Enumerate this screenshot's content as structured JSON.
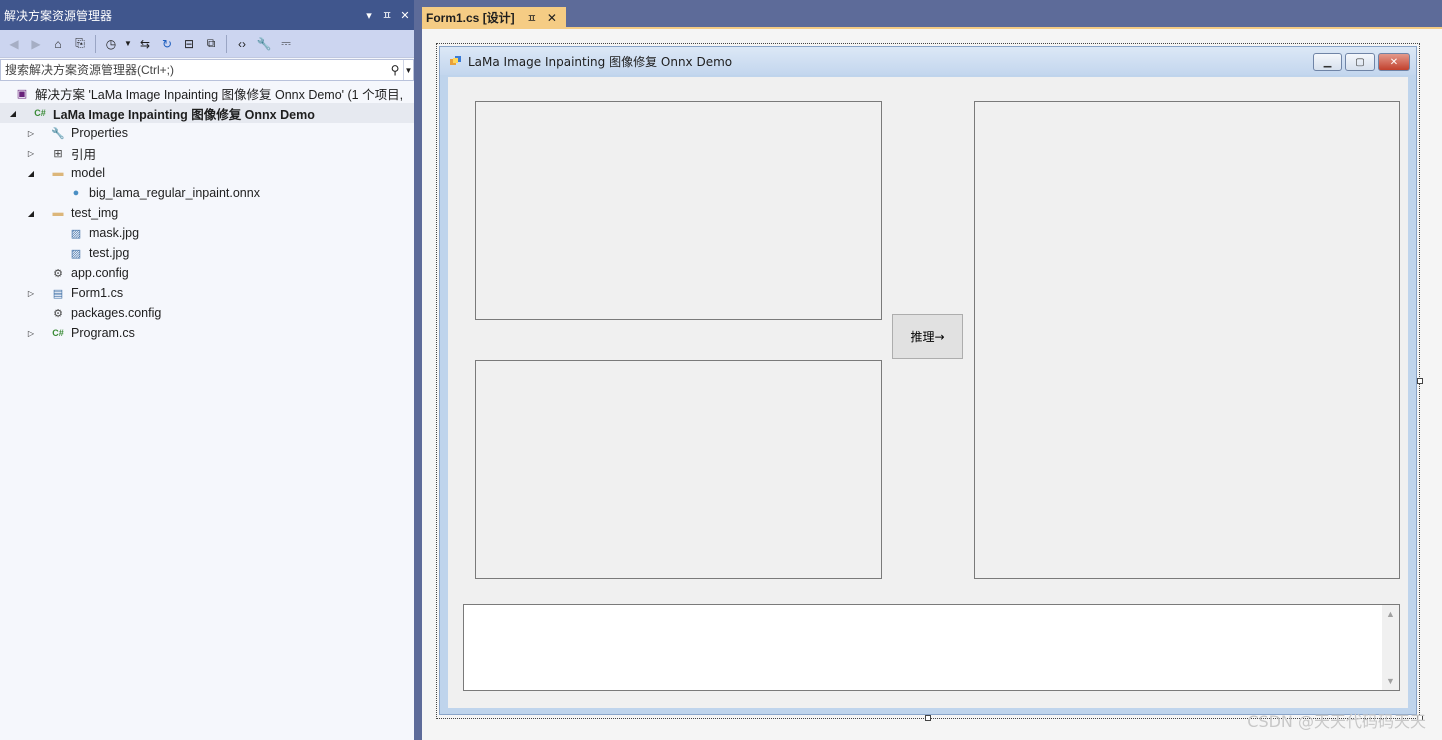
{
  "solution_explorer": {
    "title": "解决方案资源管理器",
    "title_buttons": [
      "▾",
      "ㅍ",
      "✕"
    ],
    "search_placeholder": "搜索解决方案资源管理器(Ctrl+;)",
    "tree": [
      {
        "label": "解决方案 'LaMa Image Inpainting 图像修复 Onnx Demo' (1 个项目,",
        "icon": "solution-icon",
        "depth": 0,
        "arrow": ""
      },
      {
        "label": "LaMa Image Inpainting 图像修复 Onnx Demo",
        "icon": "csharp-project-icon",
        "depth": 0,
        "arrow": "◢",
        "bold": true,
        "selected": true
      },
      {
        "label": "Properties",
        "icon": "wrench-icon",
        "depth": 1,
        "arrow": "▷"
      },
      {
        "label": "引用",
        "icon": "references-icon",
        "depth": 1,
        "arrow": "▷"
      },
      {
        "label": "model",
        "icon": "folder-icon",
        "depth": 1,
        "arrow": "◢"
      },
      {
        "label": "big_lama_regular_inpaint.onnx",
        "icon": "globe-file-icon",
        "depth": 2,
        "arrow": ""
      },
      {
        "label": "test_img",
        "icon": "folder-icon",
        "depth": 1,
        "arrow": "◢"
      },
      {
        "label": "mask.jpg",
        "icon": "image-file-icon",
        "depth": 2,
        "arrow": ""
      },
      {
        "label": "test.jpg",
        "icon": "image-file-icon",
        "depth": 2,
        "arrow": ""
      },
      {
        "label": "app.config",
        "icon": "config-file-icon",
        "depth": 1,
        "arrow": ""
      },
      {
        "label": "Form1.cs",
        "icon": "form-icon",
        "depth": 1,
        "arrow": "▷"
      },
      {
        "label": "packages.config",
        "icon": "config-file-icon",
        "depth": 1,
        "arrow": ""
      },
      {
        "label": "Program.cs",
        "icon": "csharp-file-icon",
        "depth": 1,
        "arrow": "▷"
      }
    ]
  },
  "document_tab": {
    "label": "Form1.cs [设计]",
    "pin": "ㅍ",
    "close": "✕"
  },
  "form": {
    "title": "LaMa Image Inpainting 图像修复 Onnx Demo",
    "infer_button": "推理→",
    "output_text": ""
  },
  "watermark": "CSDN @天天代码码天天",
  "colors": {
    "title_bar": "#40568d",
    "toolbar": "#ccd5f0",
    "tab_active": "#f5cc84",
    "frame": "#5d6b99"
  }
}
